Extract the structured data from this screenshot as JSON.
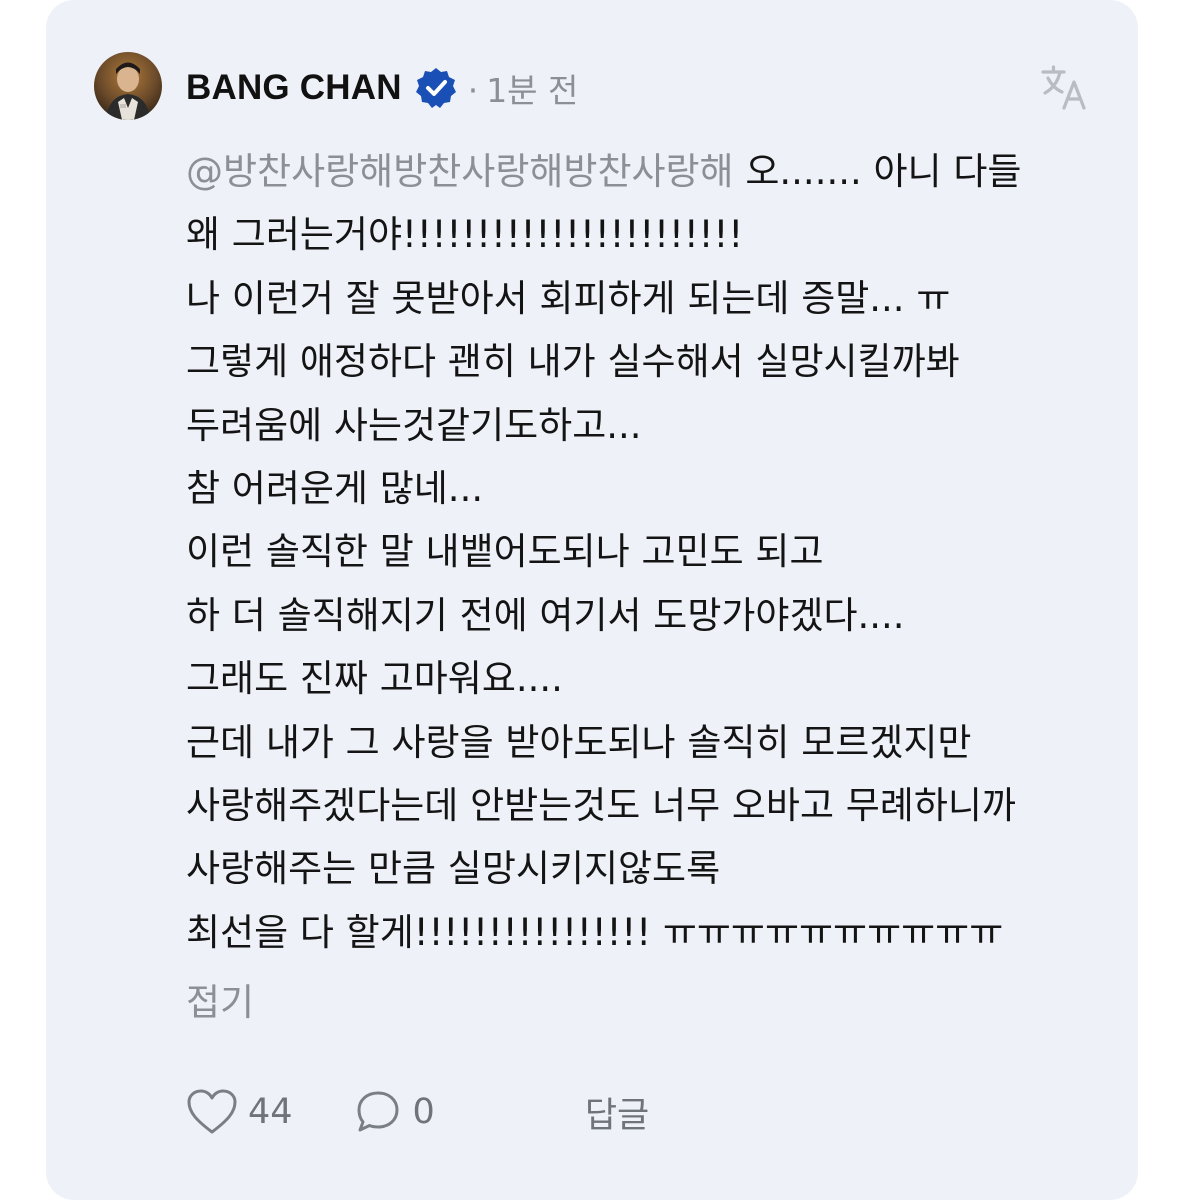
{
  "comment": {
    "username": "BANG CHAN",
    "time_separator": "·",
    "time": "1분 전",
    "mention": "@방찬사랑해방찬사랑해방찬사랑해",
    "first_line_rest": " 오....... 아니 다들",
    "lines": [
      "왜 그러는거야!!!!!!!!!!!!!!!!!!!!!!!",
      "나 이런거 잘 못받아서 회피하게 되는데 증말... ㅠ",
      "그렇게 애정하다 괜히 내가 실수해서 실망시킬까봐",
      "두려움에 사는것같기도하고...",
      "참 어려운게 많네...",
      "이런 솔직한 말 내뱉어도되나 고민도 되고",
      "하 더 솔직해지기 전에 여기서 도망가야겠다....",
      "그래도 진짜 고마워요....",
      "근데 내가 그 사랑을 받아도되나 솔직히 모르겠지만",
      "사랑해주겠다는데 안받는것도 너무 오바고 무례하니까",
      "사랑해주는 만큼 실망시키지않도록",
      "최선을 다 할게!!!!!!!!!!!!!!!! ㅠㅠㅠㅠㅠㅠㅠㅠㅠㅠ"
    ],
    "collapse_label": "접기",
    "like_count": "44",
    "reply_count": "0",
    "reply_label": "답글"
  },
  "icons": {
    "avatar": "avatar",
    "verified": "verified-badge-icon",
    "translate": "translate-icon",
    "like": "heart-icon",
    "comment": "comment-bubble-icon"
  },
  "colors": {
    "card_background": "#eef2f8",
    "text_primary": "#141414",
    "text_secondary": "#8c8f96",
    "verified_blue": "#1a4fb5"
  }
}
